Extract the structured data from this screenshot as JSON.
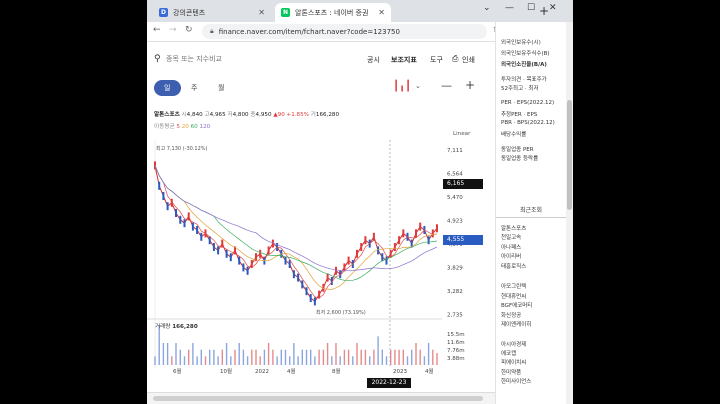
{
  "browser": {
    "tab_inactive": {
      "title": "강의콘텐츠",
      "favicon": "D",
      "favicon_color": "#3b6bd6"
    },
    "tab_active": {
      "title": "알톤스포츠 : 네이버 증권",
      "favicon": "N",
      "favicon_color": "#03c75a"
    },
    "close_glyph": "✕",
    "new_tab_glyph": "+",
    "url": "finance.naver.com/item/fchart.naver?code=123750",
    "window_controls": [
      "⌄",
      "—",
      "☐",
      "✕"
    ]
  },
  "toolbar": {
    "search_placeholder": "종목 또는 지수비교",
    "links": [
      "공시",
      "보조지표",
      "도구"
    ],
    "print_label": "인쇄",
    "period_tabs": [
      "일",
      "주",
      "월"
    ],
    "active_period": 0
  },
  "quote": {
    "name": "알톤스포츠",
    "open_label": "시",
    "open": "4,840",
    "high_label": "고",
    "high": "4,965",
    "low_label": "저",
    "low": "4,800",
    "close_label": "종",
    "close": "4,950",
    "change": "▲90 +1.85%",
    "volume_label": "거",
    "volume": "166,280",
    "ma_label": "이동평균",
    "ma_periods": [
      "5",
      "20",
      "60",
      "120"
    ],
    "ma_colors": [
      "#e04b4b",
      "#e0a13b",
      "#3cae5e",
      "#8a6fd1"
    ]
  },
  "chart_data": {
    "type": "line",
    "title": "",
    "yscale": "Linear",
    "xlabel": "",
    "ylabel": "",
    "ylim": [
      2400,
      7400
    ],
    "y_ticks": [
      "7,111",
      "6,564",
      "5,470",
      "4,923",
      "4,376",
      "3,829",
      "3,282",
      "2,735"
    ],
    "x_ticks": [
      "6월",
      "10월",
      "2022",
      "4월",
      "8월",
      "2023",
      "4월"
    ],
    "highest_label": "최고 7,130 (-30.12%)",
    "lowest_label": "최저 2,600 (73.19%)",
    "price_tag": "6,165",
    "current_tag": "4,555",
    "crosshair_date": "2022-12-23",
    "series": [
      {
        "values": [
          6800,
          6200,
          5900,
          5600,
          5700,
          5400,
          5200,
          5100,
          5300,
          5000,
          4900,
          4700,
          4800,
          4600,
          4400,
          4300,
          4500,
          4200,
          4100,
          4300,
          4000,
          3800,
          3700,
          3900,
          4100,
          4200,
          4000,
          4300,
          4500,
          4400,
          4200,
          4000,
          3900,
          3600,
          3500,
          3300,
          3100,
          2900,
          2800,
          3000,
          3200,
          3500,
          3400,
          3700,
          3600,
          3800,
          4000,
          3900,
          4200,
          4400,
          4600,
          4500,
          4700,
          4300,
          4100,
          4000,
          4200,
          4400,
          4600,
          4800,
          4700,
          4500,
          4800,
          5000,
          4900,
          4600,
          4800,
          4950
        ]
      }
    ],
    "volume_label": "거래량",
    "volume_value": "166,280",
    "volume_ticks": [
      "15.5m",
      "11.6m",
      "7.76m",
      "3.88m"
    ]
  },
  "right_panel": {
    "lines_top": [
      "외국인보유수(시)",
      "외국인보유주식수(B)",
      "외국인소진율(B/A)"
    ],
    "lines_mid": [
      "투자의견 · 목표주가",
      "52주최고 · 최저"
    ],
    "lines_per": [
      "PER · EPS(2022.12)",
      "추정PER · EPS",
      "PBR · BPS(2022.12)",
      "배당수익률"
    ],
    "lines_same": [
      "동일업종 PER",
      "동일업종 등락률"
    ],
    "recent_title": "최근조회",
    "recent": [
      "알톤스포츠",
      "천일고속",
      "아나패스",
      "아이리버",
      "태흥로직스",
      "아모그린텍",
      "현대휴먼씨",
      "BGF에코머티",
      "화신정공",
      "제이엔케이히",
      "아시아경제",
      "에코캡",
      "피에이치씨",
      "한미약품",
      "한미사이언스"
    ]
  }
}
